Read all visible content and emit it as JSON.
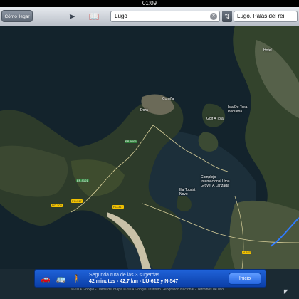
{
  "status": {
    "time": "01:09"
  },
  "toolbar": {
    "directions_label": "Cómo llegar",
    "search_value": "Lugo",
    "destination_value": "Lugo. Palas del rei"
  },
  "map": {
    "labels": {
      "coruna": "Coruña",
      "dora": "Dora",
      "golf": "Golf A Toja",
      "isla": "Isla De Toxa\nPequena",
      "complejo": "Complejo\nInternacional Uma\nGrove, A Lanzada",
      "isla_tourist": "Illa Tourist\nNovo",
      "north": "Hotel"
    },
    "roads": {
      "r1": "EP-9005",
      "r2": "EP-9101",
      "r3": "PO-317",
      "r4": "PO-317",
      "r5": "PO-303",
      "r6": "N-547"
    }
  },
  "route": {
    "line1": "Segunda ruta de las 3 sugerdas",
    "line2": "42 minutos - 42,7 km - LU-612 y N-547",
    "start_label": "Inicio",
    "modes": [
      "car-icon",
      "bus-icon",
      "walk-icon"
    ]
  },
  "copyright": "©2014 Google - Datos del mapa ©2014 Google, Instituto Geográfico Nacional - Términos de uso"
}
